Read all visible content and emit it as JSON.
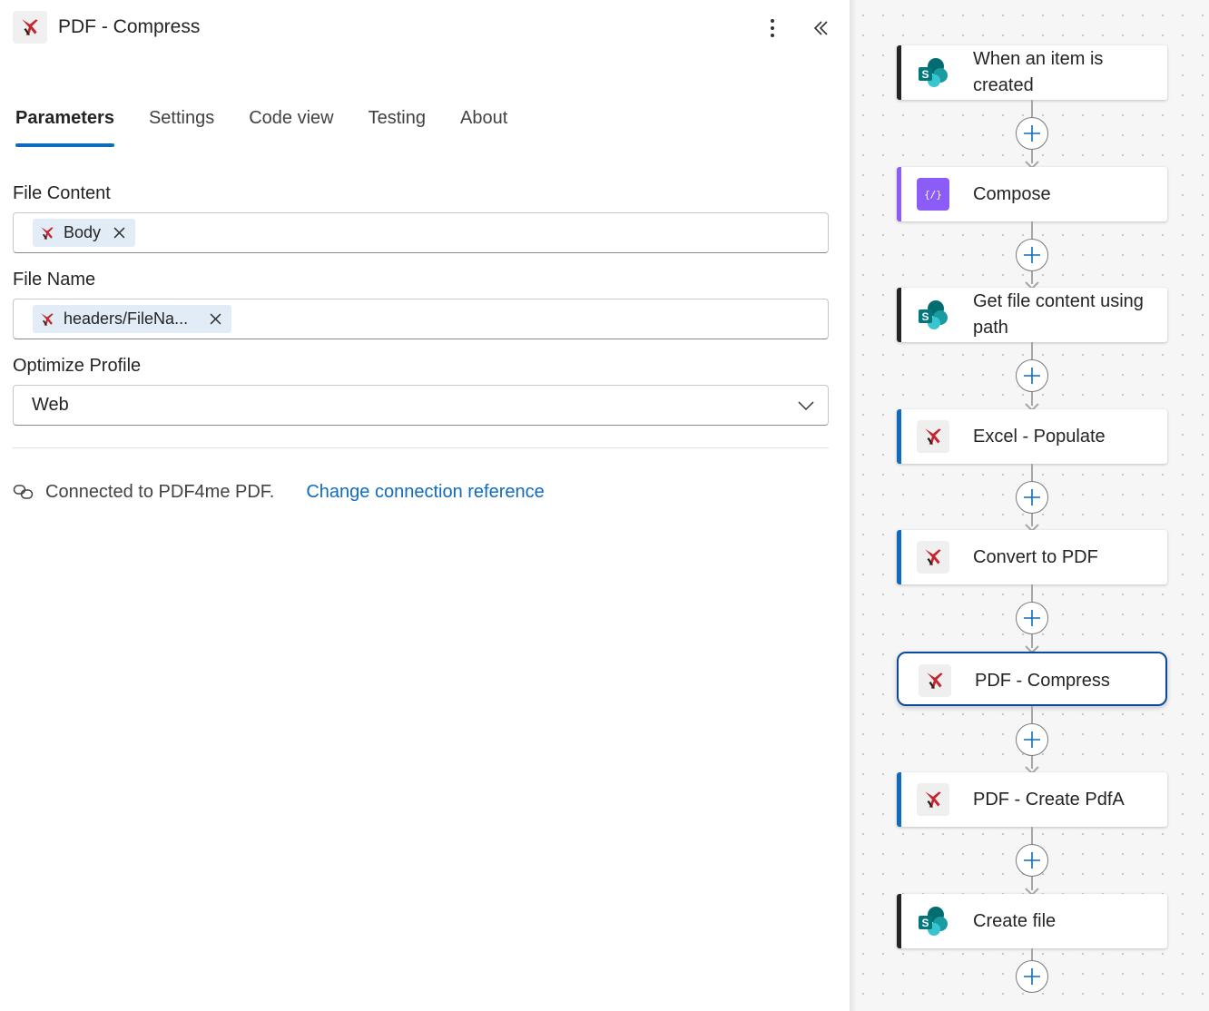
{
  "panel": {
    "title": "PDF - Compress",
    "tabs": [
      {
        "label": "Parameters",
        "active": true
      },
      {
        "label": "Settings",
        "active": false
      },
      {
        "label": "Code view",
        "active": false
      },
      {
        "label": "Testing",
        "active": false
      },
      {
        "label": "About",
        "active": false
      }
    ],
    "fields": {
      "file_content": {
        "label": "File Content",
        "token": "Body"
      },
      "file_name": {
        "label": "File Name",
        "token": "headers/FileNa..."
      },
      "optimize_profile": {
        "label": "Optimize Profile",
        "value": "Web"
      }
    },
    "connection": {
      "text": "Connected to PDF4me PDF.",
      "link": "Change connection reference"
    }
  },
  "flow": {
    "steps": [
      {
        "label": "When an item is created",
        "icon": "sharepoint-icon",
        "bar_color": "#242424",
        "selected": false
      },
      {
        "label": "Compose",
        "icon": "compose-icon",
        "bar_color": "#8b5cf6",
        "selected": false
      },
      {
        "label": "Get file content using path",
        "icon": "sharepoint-icon",
        "bar_color": "#242424",
        "selected": false
      },
      {
        "label": "Excel - Populate",
        "icon": "pdf4me-icon",
        "bar_color": "#0f6cbd",
        "selected": false
      },
      {
        "label": "Convert to PDF",
        "icon": "pdf4me-icon",
        "bar_color": "#0f6cbd",
        "selected": false
      },
      {
        "label": "PDF - Compress",
        "icon": "pdf4me-icon",
        "bar_color": "#0f6cbd",
        "selected": true
      },
      {
        "label": "PDF - Create PdfA",
        "icon": "pdf4me-icon",
        "bar_color": "#0f6cbd",
        "selected": false
      },
      {
        "label": "Create file",
        "icon": "sharepoint-icon",
        "bar_color": "#242424",
        "selected": false
      }
    ]
  },
  "colors": {
    "accent": "#0f6cbd",
    "selected_border": "#0a4a9c",
    "token_bg": "#e1ecf7",
    "pdf4me_red": "#c4262e"
  }
}
